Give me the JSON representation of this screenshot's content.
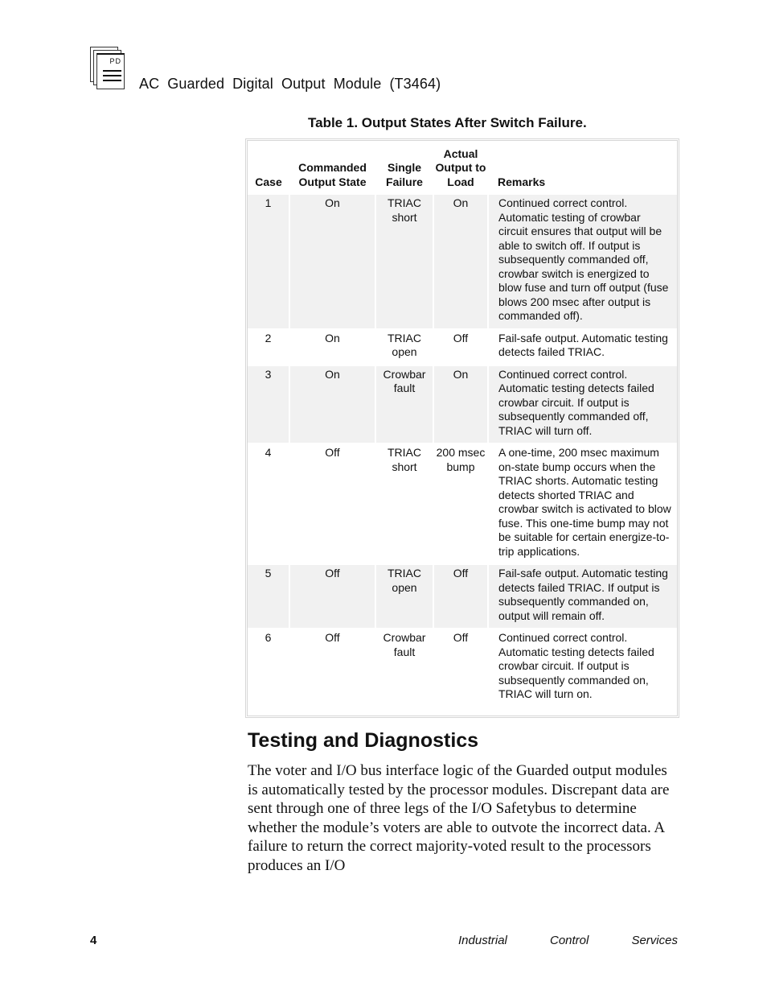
{
  "header": {
    "icon_label": "PD",
    "icon": "document-stack-icon",
    "title": "AC  Guarded  Digital  Output  Module (T3464)"
  },
  "table": {
    "caption": "Table 1.  Output States After Switch Failure.",
    "columns": [
      {
        "key": "case",
        "label": "Case"
      },
      {
        "key": "commanded",
        "label": "Commanded Output State"
      },
      {
        "key": "single_failure",
        "label": "Single Failure"
      },
      {
        "key": "actual_output",
        "label": "Actual Output to Load"
      },
      {
        "key": "remarks",
        "label": "Remarks"
      }
    ],
    "rows": [
      {
        "case": "1",
        "commanded": "On",
        "single_failure": "TRIAC short",
        "actual_output": "On",
        "remarks": "Continued correct control. Automatic testing of crowbar circuit ensures that output will be able to switch off.  If output is subsequently commanded off, crowbar switch is energized to blow fuse and turn off output (fuse blows 200 msec after output is commanded off)."
      },
      {
        "case": "2",
        "commanded": "On",
        "single_failure": "TRIAC open",
        "actual_output": "Off",
        "remarks": "Fail-safe output.  Automatic testing detects failed TRIAC."
      },
      {
        "case": "3",
        "commanded": "On",
        "single_failure": "Crowbar fault",
        "actual_output": "On",
        "remarks": "Continued correct control. Automatic testing detects failed crowbar circuit.  If output is subsequently commanded off, TRIAC will turn off."
      },
      {
        "case": "4",
        "commanded": "Off",
        "single_failure": "TRIAC short",
        "actual_output": "200 msec bump",
        "remarks": "A one-time, 200 msec maximum on-state bump occurs when the TRIAC shorts.  Automatic testing detects shorted TRIAC and crowbar switch is activated to blow fuse.  This one-time bump may not be suitable for certain energize-to-trip applications."
      },
      {
        "case": "5",
        "commanded": "Off",
        "single_failure": "TRIAC open",
        "actual_output": "Off",
        "remarks": "Fail-safe output.  Automatic testing detects failed TRIAC.  If output is subsequently commanded on, output will remain off."
      },
      {
        "case": "6",
        "commanded": "Off",
        "single_failure": "Crowbar fault",
        "actual_output": "Off",
        "remarks": "Continued correct control. Automatic testing detects failed crowbar circuit.  If output is subsequently commanded on, TRIAC will turn on."
      }
    ]
  },
  "section": {
    "heading": "Testing and Diagnostics",
    "paragraph": "The voter and I/O bus interface logic of the Guarded output modules is automatically tested by the processor modules. Discrepant data are sent through one of three legs of the I/O Safetybus to determine whether the module’s voters are able to outvote the incorrect data.  A failure to return the correct majority-voted result to the processors produces an I/O"
  },
  "footer": {
    "page_number": "4",
    "company_words": [
      "Industrial",
      "Control",
      "Services"
    ]
  }
}
